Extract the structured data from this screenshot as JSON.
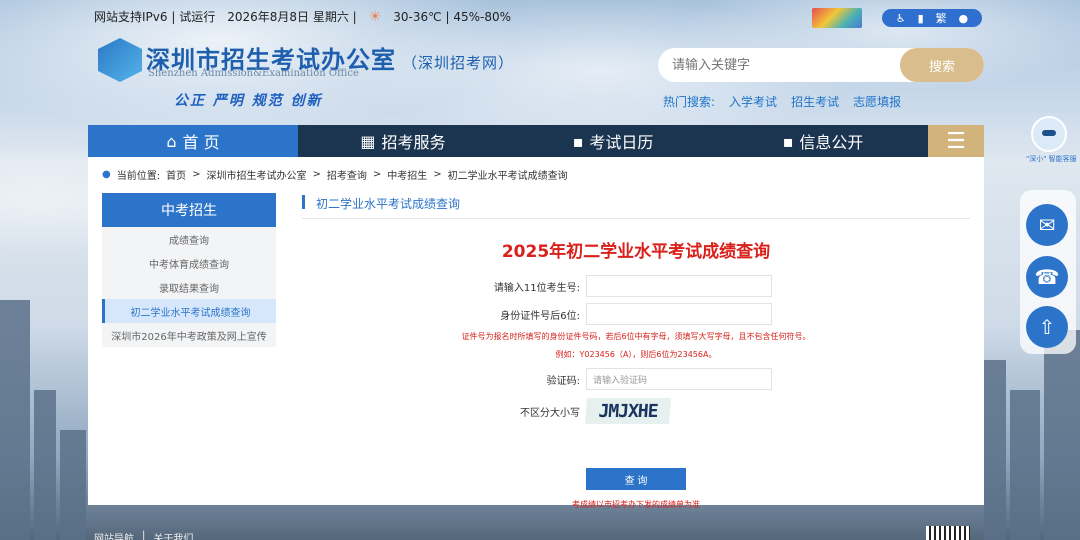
{
  "topbar": {
    "ipv6": "网站支持IPv6",
    "trial": "试运行",
    "date": "2026年8月8日",
    "weekday": "星期六",
    "weather": "30-36℃",
    "humidity": "45%-80%"
  },
  "accessibility": {
    "large_text": "繁"
  },
  "logo": {
    "title": "深圳市招生考试办公室",
    "subtitle": "（深圳招考网）",
    "english": "Shenzhen Admission&Examination Office",
    "slogan": "公正 严明 规范 创新"
  },
  "search": {
    "placeholder": "请输入关键字",
    "button": "搜索",
    "hot_label": "热门搜索:",
    "hot_terms": [
      "入学考试",
      "招生考试",
      "志愿填报"
    ]
  },
  "nav": {
    "home": "首 页",
    "service": "招考服务",
    "calendar": "考试日历",
    "info": "信息公开",
    "menu_icon": "☰"
  },
  "breadcrumb": {
    "label": "当前位置:",
    "items": [
      "首页",
      "深圳市招生考试办公室",
      "招考查询",
      "中考招生",
      "初二学业水平考试成绩查询"
    ]
  },
  "sidebar": {
    "heading": "中考招生",
    "items": [
      {
        "label": "成绩查询"
      },
      {
        "label": "中考体育成绩查询"
      },
      {
        "label": "录取结果查询"
      },
      {
        "label": "初二学业水平考试成绩查询"
      },
      {
        "label": "深圳市2026年中考政策及网上宣传"
      }
    ]
  },
  "content": {
    "section_title": "初二学业水平考试成绩查询",
    "query_title": "2025年初二学业水平考试成绩查询",
    "exam_no_label": "请输入11位考生号:",
    "id_label": "身份证件号后6位:",
    "note1": "证件号为报名时所填写的身份证件号码，若后6位中有字母，须填写大写字母，且不包含任何符号。",
    "note2": "例如：Y023456（A），则后6位为23456A。",
    "captcha_label": "验证码:",
    "captcha_placeholder": "请输入验证码",
    "case_hint": "不区分大小写",
    "captcha_text": "JMJXHE",
    "submit": "查 询",
    "footnote": "考成绩以市招考办下发的成绩单为准"
  },
  "floating": {
    "robot_caption": "\"深小\" 智能客服"
  },
  "footer": {
    "nav": "网站导航",
    "about": "关于我们"
  }
}
